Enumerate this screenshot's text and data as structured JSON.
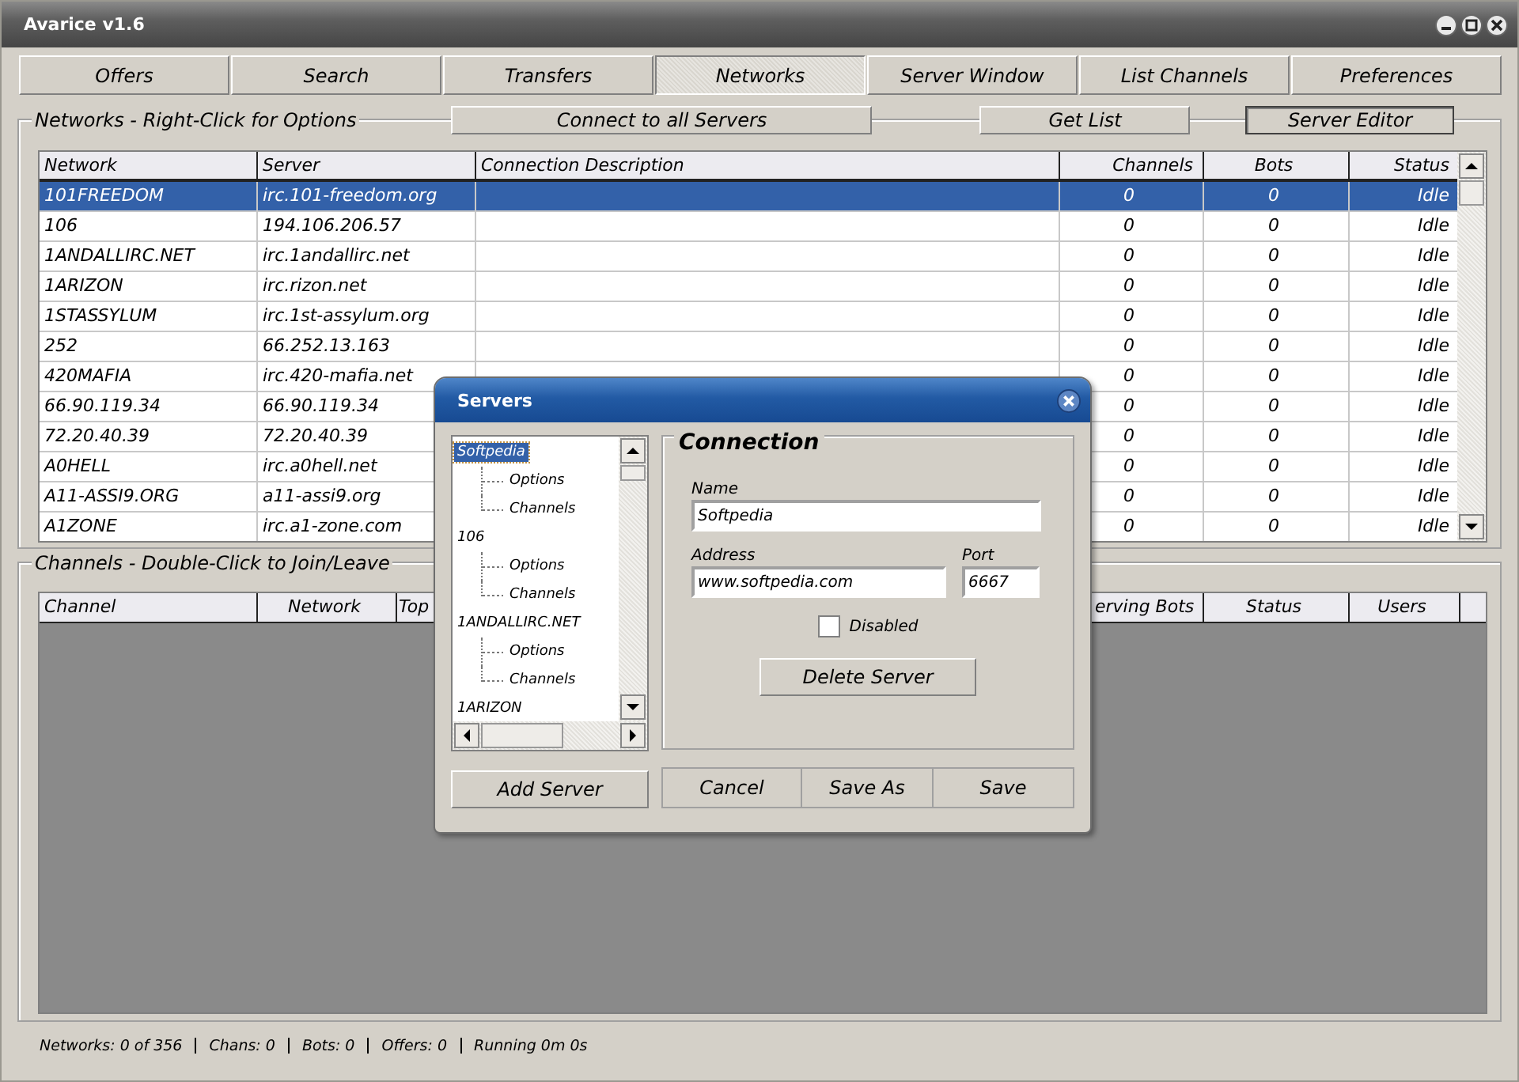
{
  "window": {
    "title": "Avarice v1.6"
  },
  "tabs": [
    {
      "label": "Offers",
      "selected": false
    },
    {
      "label": "Search",
      "selected": false
    },
    {
      "label": "Transfers",
      "selected": false
    },
    {
      "label": "Networks",
      "selected": true
    },
    {
      "label": "Server Window",
      "selected": false
    },
    {
      "label": "List Channels",
      "selected": false
    },
    {
      "label": "Preferences",
      "selected": false
    }
  ],
  "networks_panel": {
    "legend": "Networks - Right-Click for Options",
    "buttons": [
      {
        "label": "Connect to all Servers",
        "pressed": false
      },
      {
        "label": "Get List",
        "pressed": false
      },
      {
        "label": "Server Editor",
        "pressed": true
      }
    ],
    "table": {
      "columns": [
        "Network",
        "Server",
        "Connection Description",
        "Channels",
        "Bots",
        "Status"
      ],
      "rows": [
        {
          "network": "101FREEDOM",
          "server": "irc.101-freedom.org",
          "channels": "0",
          "bots": "0",
          "status": "Idle",
          "selected": true
        },
        {
          "network": "106",
          "server": "194.106.206.57",
          "channels": "0",
          "bots": "0",
          "status": "Idle",
          "selected": false
        },
        {
          "network": "1ANDALLIRC.NET",
          "server": "irc.1andallirc.net",
          "channels": "0",
          "bots": "0",
          "status": "Idle",
          "selected": false
        },
        {
          "network": "1ARIZON",
          "server": "irc.rizon.net",
          "channels": "0",
          "bots": "0",
          "status": "Idle",
          "selected": false
        },
        {
          "network": "1STASSYLUM",
          "server": "irc.1st-assylum.org",
          "channels": "0",
          "bots": "0",
          "status": "Idle",
          "selected": false
        },
        {
          "network": "252",
          "server": "66.252.13.163",
          "channels": "0",
          "bots": "0",
          "status": "Idle",
          "selected": false
        },
        {
          "network": "420MAFIA",
          "server": "irc.420-mafia.net",
          "channels": "0",
          "bots": "0",
          "status": "Idle",
          "selected": false
        },
        {
          "network": "66.90.119.34",
          "server": "66.90.119.34",
          "channels": "0",
          "bots": "0",
          "status": "Idle",
          "selected": false
        },
        {
          "network": "72.20.40.39",
          "server": "72.20.40.39",
          "channels": "0",
          "bots": "0",
          "status": "Idle",
          "selected": false
        },
        {
          "network": "A0HELL",
          "server": "irc.a0hell.net",
          "channels": "0",
          "bots": "0",
          "status": "Idle",
          "selected": false
        },
        {
          "network": "A11-ASSI9.ORG",
          "server": "a11-assi9.org",
          "channels": "0",
          "bots": "0",
          "status": "Idle",
          "selected": false
        },
        {
          "network": "A1ZONE",
          "server": "irc.a1-zone.com",
          "channels": "0",
          "bots": "0",
          "status": "Idle",
          "selected": false
        }
      ]
    }
  },
  "channels_panel": {
    "legend": "Channels - Double-Click to Join/Leave",
    "table": {
      "columns": [
        "Channel",
        "Network",
        "Top",
        "erving Bots",
        "Status",
        "Users"
      ]
    }
  },
  "dialog": {
    "title": "Servers",
    "tree": [
      {
        "label": "Softpedia",
        "selected": true,
        "children": [
          {
            "label": "Options",
            "selected": false
          },
          {
            "label": "Channels",
            "selected": false
          }
        ]
      },
      {
        "label": "106",
        "selected": false,
        "children": [
          {
            "label": "Options",
            "selected": false
          },
          {
            "label": "Channels",
            "selected": false
          }
        ]
      },
      {
        "label": "1ANDALLIRC.NET",
        "selected": false,
        "children": [
          {
            "label": "Options",
            "selected": false
          },
          {
            "label": "Channels",
            "selected": false
          }
        ]
      },
      {
        "label": "1ARIZON",
        "selected": false
      }
    ],
    "connection": {
      "legend": "Connection",
      "name_label": "Name",
      "name_value": "Softpedia",
      "address_label": "Address",
      "address_value": "www.softpedia.com",
      "port_label": "Port",
      "port_value": "6667",
      "disabled": {
        "label": "Disabled",
        "checked": false
      },
      "delete_button": "Delete Server"
    },
    "add_button": "Add Server",
    "buttons": [
      "Cancel",
      "Save As",
      "Save"
    ]
  },
  "status_bar": [
    "Networks: 0 of 356",
    "Chans: 0",
    "Bots: 0",
    "Offers: 0",
    "Running 0m 0s"
  ]
}
